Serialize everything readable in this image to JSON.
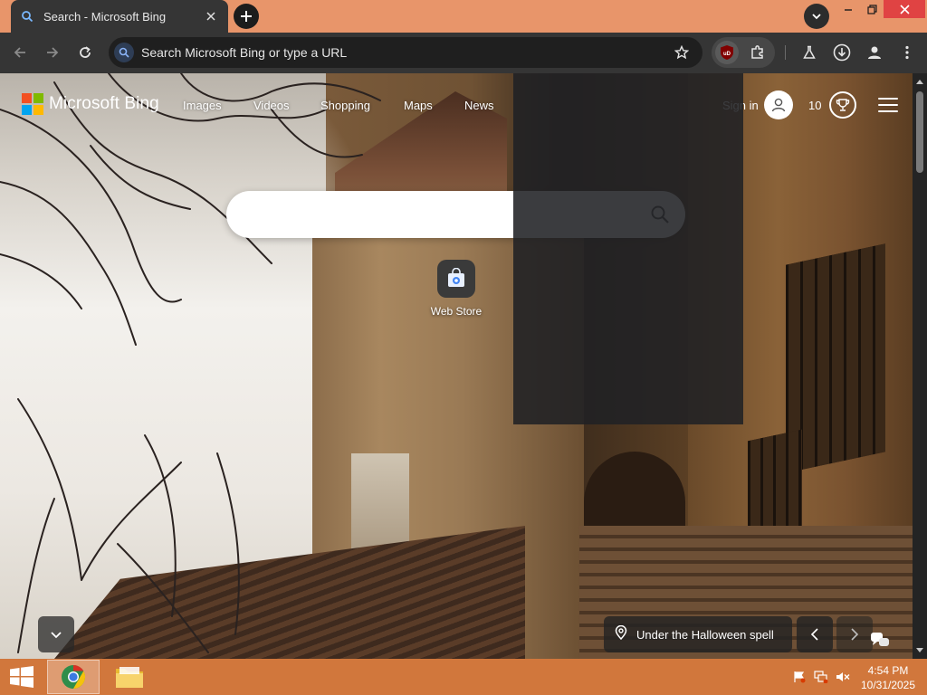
{
  "browser": {
    "tab_title": "Search - Microsoft Bing",
    "omnibox_placeholder": "Search Microsoft Bing or type a URL",
    "extension_label": "uD"
  },
  "bing": {
    "logo_text": "Microsoft Bing",
    "nav": [
      "Images",
      "Videos",
      "Shopping",
      "Maps",
      "News"
    ],
    "sign_in": "Sign in",
    "rewards_count": "10",
    "search_value": "",
    "tile_label": "Web Store",
    "caption": "Under the Halloween spell"
  },
  "taskbar": {
    "time": "4:54 PM",
    "date": "10/31/2025"
  },
  "colors": {
    "titlebar": "#e8956a",
    "toolbar": "#353535",
    "taskbar": "#d1773c",
    "ms_red": "#f25022",
    "ms_green": "#7fba00",
    "ms_blue": "#00a4ef",
    "ms_yellow": "#ffb900"
  },
  "icons": [
    "search-icon",
    "close-icon",
    "plus-icon",
    "chevron-down-icon",
    "back-arrow-icon",
    "forward-arrow-icon",
    "reload-icon",
    "star-icon",
    "ublock-icon",
    "puzzle-icon",
    "labs-flask-icon",
    "download-icon",
    "profile-icon",
    "kebab-menu-icon",
    "user-icon",
    "trophy-icon",
    "hamburger-icon",
    "web-store-icon",
    "location-pin-icon",
    "chevron-left-icon",
    "chevron-right-icon",
    "chat-icon",
    "windows-logo-icon",
    "chrome-icon",
    "folder-icon",
    "flag-icon",
    "network-icon",
    "speaker-muted-icon"
  ]
}
